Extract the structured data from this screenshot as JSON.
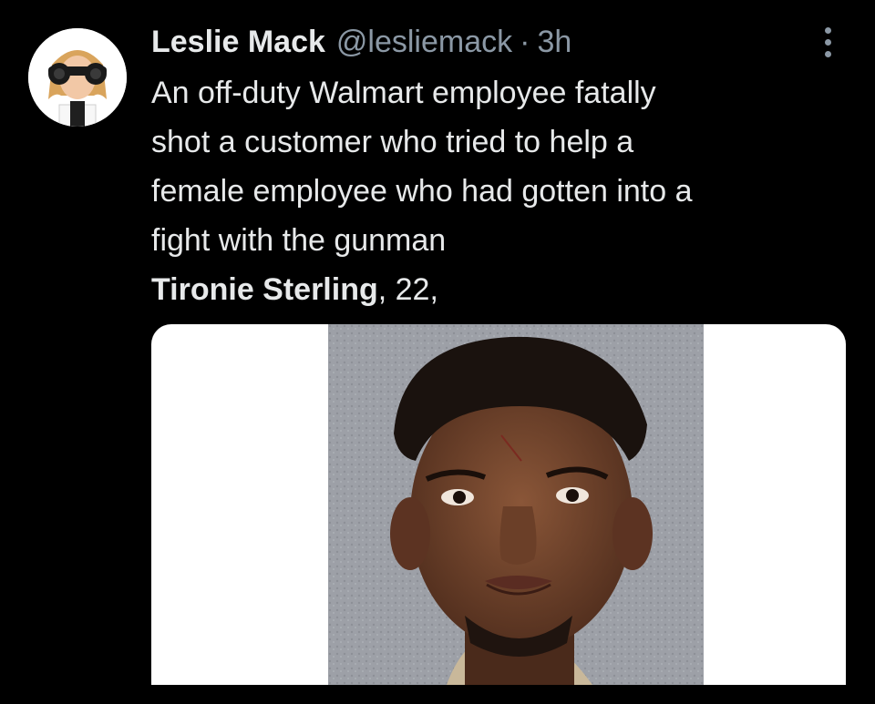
{
  "tweet": {
    "author": {
      "name": "Leslie Mack",
      "handle": "@lesliemack"
    },
    "separator": "·",
    "timestamp": "3h",
    "text_lines": [
      "An off-duty Walmart employee fatally",
      "shot a customer who tried to help a",
      "female employee who had gotten into a",
      "fight with the gunman"
    ],
    "last_line": {
      "bold": "Tironie Sterling",
      "rest": ", 22,"
    },
    "icons": {
      "more": "more-vertical-icon",
      "avatar": "avatar-binoculars"
    }
  },
  "colors": {
    "background": "#000000",
    "text": "#e7e9ea",
    "secondary_text": "#8b98a5",
    "media_background": "#ffffff"
  }
}
